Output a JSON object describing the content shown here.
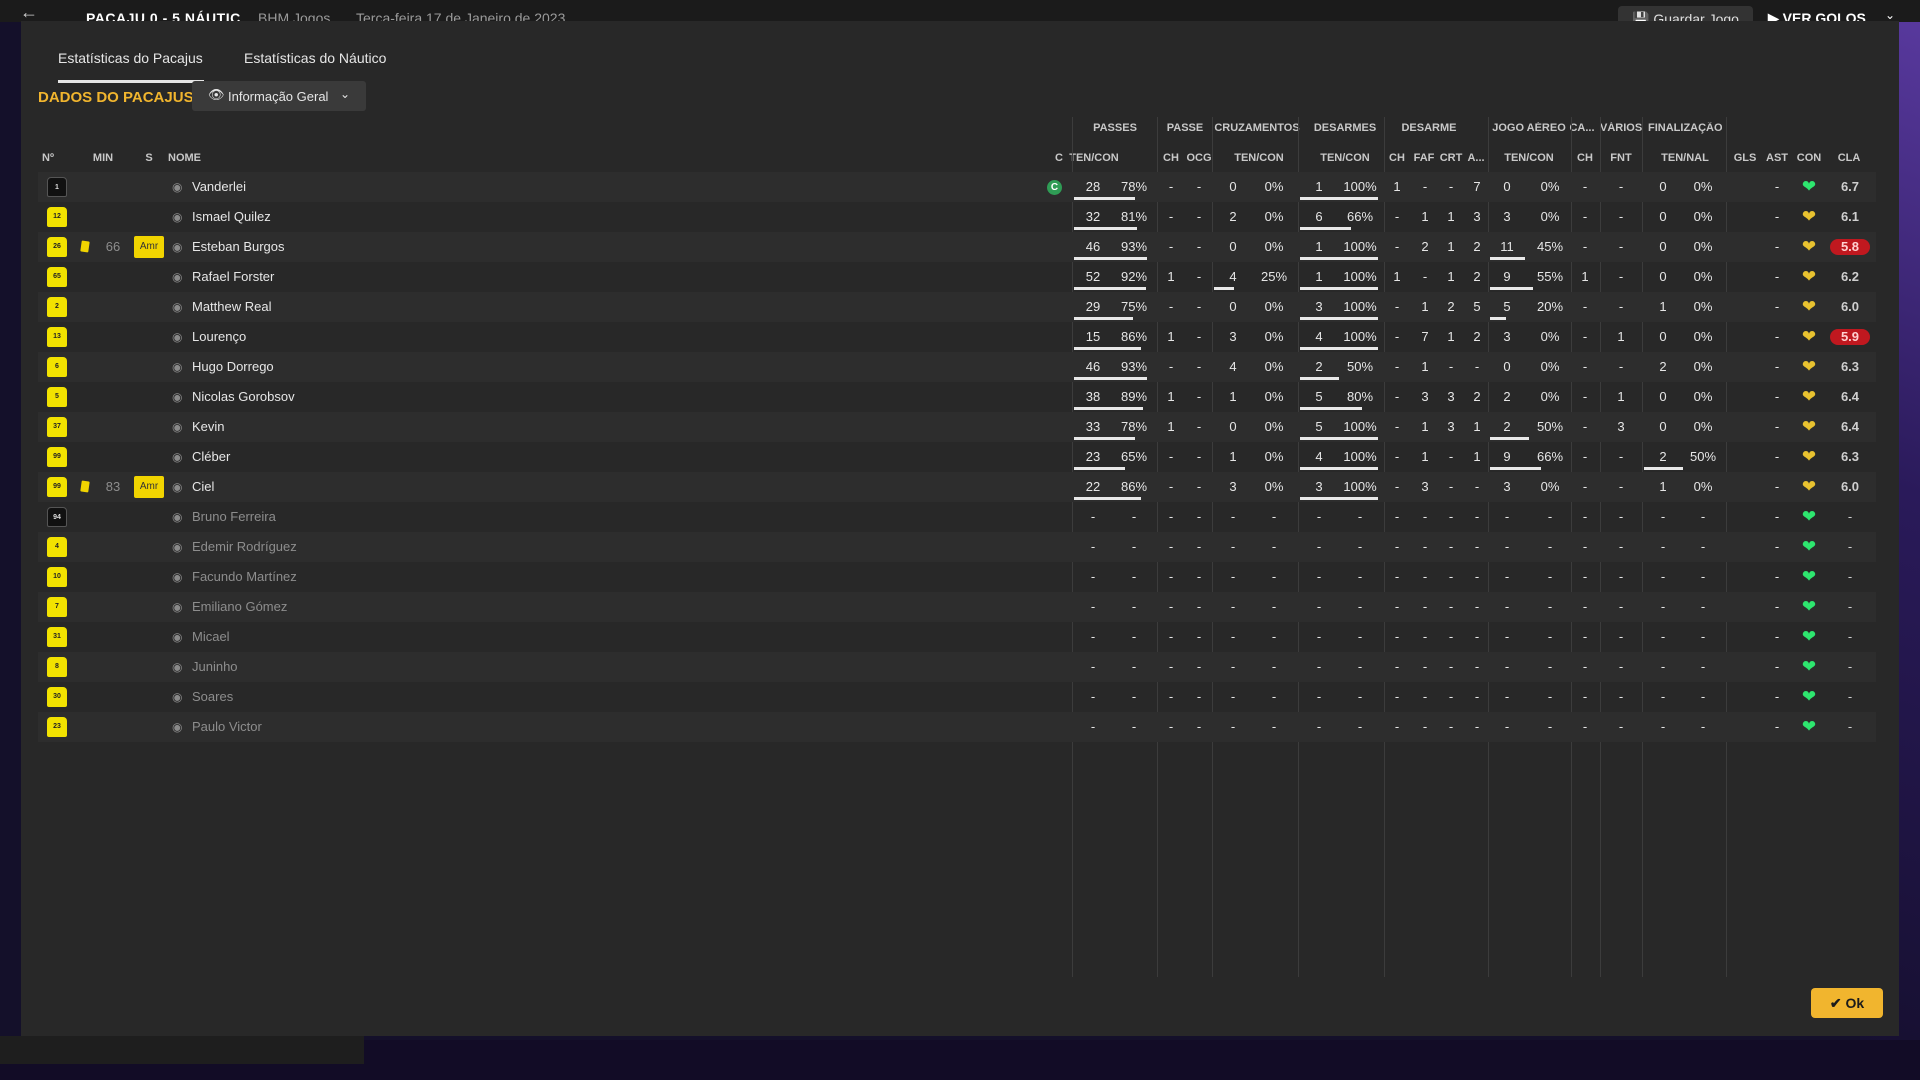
{
  "topbar": {
    "back_icon": "arrow-left-icon",
    "score": "PACAJU 0 - 5 NÁUTIC",
    "competition": "BHM Jogos",
    "date": "Terça-feira 17 de Janeiro de 2023",
    "save_button": "Guardar Jogo",
    "goals_button": "VER GOLOS"
  },
  "tabs": [
    "Estatísticas do Pacajus",
    "Estatísticas do Náutico"
  ],
  "section_title": "DADOS DO PACAJUS",
  "view_dropdown": "Informação Geral",
  "group_headers": [
    "PASSES",
    "PASSE",
    "CRUZAMENTOS",
    "DESARMES",
    "DESARME",
    "JOGO AÉREO",
    "CA...",
    "VÁRIOS",
    "FINALIZAÇÃO"
  ],
  "columns": [
    "Nº",
    "MIN",
    "S",
    "NOME",
    "C",
    "TEN/CON",
    "CH",
    "OCG",
    "TEN/CON",
    "TEN/CON",
    "CH",
    "FAF",
    "CRT",
    "A...",
    "TEN/CON",
    "CH",
    "FNT",
    "TEN/NAL",
    "GLS",
    "AST",
    "CON",
    "CLA"
  ],
  "colors": {
    "accent": "#f1b52e",
    "shirt": "#f2e200",
    "heart_green": "#2ee66f",
    "heart_yellow": "#e8c230",
    "bad_rating": "#c0181f"
  },
  "players": [
    {
      "num": "1",
      "gk": true,
      "min": "",
      "card": false,
      "role": "",
      "name": "Vanderlei",
      "captain": true,
      "pass_t": "28",
      "pass_p": "78%",
      "pass_bar": 78,
      "pch": "-",
      "ocg": "-",
      "cru_t": "0",
      "cru_p": "0%",
      "cru_bar": 0,
      "des_t": "1",
      "des_p": "100%",
      "des_bar": 100,
      "dch": "1",
      "faf": "-",
      "crt": "-",
      "a": "7",
      "air_t": "0",
      "air_p": "0%",
      "air_bar": 0,
      "ca": "-",
      "fnt": "-",
      "fin_t": "0",
      "fin_p": "0%",
      "fin_bar": 0,
      "gls": "",
      "ast": "-",
      "heart": "green",
      "rating": "6.7",
      "bad": false
    },
    {
      "num": "12",
      "gk": false,
      "min": "",
      "card": false,
      "role": "",
      "name": "Ismael Quilez",
      "captain": false,
      "pass_t": "32",
      "pass_p": "81%",
      "pass_bar": 81,
      "pch": "-",
      "ocg": "-",
      "cru_t": "2",
      "cru_p": "0%",
      "cru_bar": 0,
      "des_t": "6",
      "des_p": "66%",
      "des_bar": 66,
      "dch": "-",
      "faf": "1",
      "crt": "1",
      "a": "3",
      "air_t": "3",
      "air_p": "0%",
      "air_bar": 0,
      "ca": "-",
      "fnt": "-",
      "fin_t": "0",
      "fin_p": "0%",
      "fin_bar": 0,
      "gls": "",
      "ast": "-",
      "heart": "yellow",
      "rating": "6.1",
      "bad": false
    },
    {
      "num": "26",
      "gk": false,
      "min": "66",
      "card": true,
      "role": "Amr",
      "name": "Esteban Burgos",
      "captain": false,
      "pass_t": "46",
      "pass_p": "93%",
      "pass_bar": 93,
      "pch": "-",
      "ocg": "-",
      "cru_t": "0",
      "cru_p": "0%",
      "cru_bar": 0,
      "des_t": "1",
      "des_p": "100%",
      "des_bar": 100,
      "dch": "-",
      "faf": "2",
      "crt": "1",
      "a": "2",
      "air_t": "11",
      "air_p": "45%",
      "air_bar": 45,
      "ca": "-",
      "fnt": "-",
      "fin_t": "0",
      "fin_p": "0%",
      "fin_bar": 0,
      "gls": "",
      "ast": "-",
      "heart": "yellow",
      "rating": "5.8",
      "bad": true
    },
    {
      "num": "65",
      "gk": false,
      "min": "",
      "card": false,
      "role": "",
      "name": "Rafael Forster",
      "captain": false,
      "pass_t": "52",
      "pass_p": "92%",
      "pass_bar": 92,
      "pch": "1",
      "ocg": "-",
      "cru_t": "4",
      "cru_p": "25%",
      "cru_bar": 25,
      "des_t": "1",
      "des_p": "100%",
      "des_bar": 100,
      "dch": "1",
      "faf": "-",
      "crt": "1",
      "a": "2",
      "air_t": "9",
      "air_p": "55%",
      "air_bar": 55,
      "ca": "1",
      "fnt": "-",
      "fin_t": "0",
      "fin_p": "0%",
      "fin_bar": 0,
      "gls": "",
      "ast": "-",
      "heart": "yellow",
      "rating": "6.2",
      "bad": false
    },
    {
      "num": "2",
      "gk": false,
      "min": "",
      "card": false,
      "role": "",
      "name": "Matthew Real",
      "captain": false,
      "pass_t": "29",
      "pass_p": "75%",
      "pass_bar": 75,
      "pch": "-",
      "ocg": "-",
      "cru_t": "0",
      "cru_p": "0%",
      "cru_bar": 0,
      "des_t": "3",
      "des_p": "100%",
      "des_bar": 100,
      "dch": "-",
      "faf": "1",
      "crt": "2",
      "a": "5",
      "air_t": "5",
      "air_p": "20%",
      "air_bar": 20,
      "ca": "-",
      "fnt": "-",
      "fin_t": "1",
      "fin_p": "0%",
      "fin_bar": 0,
      "gls": "",
      "ast": "-",
      "heart": "yellow",
      "rating": "6.0",
      "bad": false
    },
    {
      "num": "13",
      "gk": false,
      "min": "",
      "card": false,
      "role": "",
      "name": "Lourenço",
      "captain": false,
      "pass_t": "15",
      "pass_p": "86%",
      "pass_bar": 86,
      "pch": "1",
      "ocg": "-",
      "cru_t": "3",
      "cru_p": "0%",
      "cru_bar": 0,
      "des_t": "4",
      "des_p": "100%",
      "des_bar": 100,
      "dch": "-",
      "faf": "7",
      "crt": "1",
      "a": "2",
      "air_t": "3",
      "air_p": "0%",
      "air_bar": 0,
      "ca": "-",
      "fnt": "1",
      "fin_t": "0",
      "fin_p": "0%",
      "fin_bar": 0,
      "gls": "",
      "ast": "-",
      "heart": "yellow",
      "rating": "5.9",
      "bad": true
    },
    {
      "num": "6",
      "gk": false,
      "min": "",
      "card": false,
      "role": "",
      "name": "Hugo Dorrego",
      "captain": false,
      "pass_t": "46",
      "pass_p": "93%",
      "pass_bar": 93,
      "pch": "-",
      "ocg": "-",
      "cru_t": "4",
      "cru_p": "0%",
      "cru_bar": 0,
      "des_t": "2",
      "des_p": "50%",
      "des_bar": 50,
      "dch": "-",
      "faf": "1",
      "crt": "-",
      "a": "-",
      "air_t": "0",
      "air_p": "0%",
      "air_bar": 0,
      "ca": "-",
      "fnt": "-",
      "fin_t": "2",
      "fin_p": "0%",
      "fin_bar": 0,
      "gls": "",
      "ast": "-",
      "heart": "yellow",
      "rating": "6.3",
      "bad": false
    },
    {
      "num": "5",
      "gk": false,
      "min": "",
      "card": false,
      "role": "",
      "name": "Nicolas Gorobsov",
      "captain": false,
      "pass_t": "38",
      "pass_p": "89%",
      "pass_bar": 89,
      "pch": "1",
      "ocg": "-",
      "cru_t": "1",
      "cru_p": "0%",
      "cru_bar": 0,
      "des_t": "5",
      "des_p": "80%",
      "des_bar": 80,
      "dch": "-",
      "faf": "3",
      "crt": "3",
      "a": "2",
      "air_t": "2",
      "air_p": "0%",
      "air_bar": 0,
      "ca": "-",
      "fnt": "1",
      "fin_t": "0",
      "fin_p": "0%",
      "fin_bar": 0,
      "gls": "",
      "ast": "-",
      "heart": "yellow",
      "rating": "6.4",
      "bad": false
    },
    {
      "num": "37",
      "gk": false,
      "min": "",
      "card": false,
      "role": "",
      "name": "Kevin",
      "captain": false,
      "pass_t": "33",
      "pass_p": "78%",
      "pass_bar": 78,
      "pch": "1",
      "ocg": "-",
      "cru_t": "0",
      "cru_p": "0%",
      "cru_bar": 0,
      "des_t": "5",
      "des_p": "100%",
      "des_bar": 100,
      "dch": "-",
      "faf": "1",
      "crt": "3",
      "a": "1",
      "air_t": "2",
      "air_p": "50%",
      "air_bar": 50,
      "ca": "-",
      "fnt": "3",
      "fin_t": "0",
      "fin_p": "0%",
      "fin_bar": 0,
      "gls": "",
      "ast": "-",
      "heart": "yellow",
      "rating": "6.4",
      "bad": false
    },
    {
      "num": "99",
      "gk": false,
      "min": "",
      "card": false,
      "role": "",
      "name": "Cléber",
      "captain": false,
      "pass_t": "23",
      "pass_p": "65%",
      "pass_bar": 65,
      "pch": "-",
      "ocg": "-",
      "cru_t": "1",
      "cru_p": "0%",
      "cru_bar": 0,
      "des_t": "4",
      "des_p": "100%",
      "des_bar": 100,
      "dch": "-",
      "faf": "1",
      "crt": "-",
      "a": "1",
      "air_t": "9",
      "air_p": "66%",
      "air_bar": 66,
      "ca": "-",
      "fnt": "-",
      "fin_t": "2",
      "fin_p": "50%",
      "fin_bar": 50,
      "gls": "",
      "ast": "-",
      "heart": "yellow",
      "rating": "6.3",
      "bad": false
    },
    {
      "num": "99",
      "gk": false,
      "min": "83",
      "card": true,
      "role": "Amr",
      "name": "Ciel",
      "captain": false,
      "pass_t": "22",
      "pass_p": "86%",
      "pass_bar": 86,
      "pch": "-",
      "ocg": "-",
      "cru_t": "3",
      "cru_p": "0%",
      "cru_bar": 0,
      "des_t": "3",
      "des_p": "100%",
      "des_bar": 100,
      "dch": "-",
      "faf": "3",
      "crt": "-",
      "a": "-",
      "air_t": "3",
      "air_p": "0%",
      "air_bar": 0,
      "ca": "-",
      "fnt": "-",
      "fin_t": "1",
      "fin_p": "0%",
      "fin_bar": 0,
      "gls": "",
      "ast": "-",
      "heart": "yellow",
      "rating": "6.0",
      "bad": false
    },
    {
      "num": "94",
      "gk": true,
      "sub": true,
      "name": "Bruno Ferreira",
      "heart": "green"
    },
    {
      "num": "4",
      "sub": true,
      "name": "Edemir Rodríguez",
      "heart": "green"
    },
    {
      "num": "10",
      "sub": true,
      "name": "Facundo Martínez",
      "heart": "green"
    },
    {
      "num": "7",
      "sub": true,
      "name": "Emiliano Gómez",
      "heart": "green"
    },
    {
      "num": "31",
      "sub": true,
      "name": "Micael",
      "heart": "green"
    },
    {
      "num": "8",
      "sub": true,
      "name": "Juninho",
      "heart": "green"
    },
    {
      "num": "30",
      "sub": true,
      "name": "Soares",
      "heart": "green"
    },
    {
      "num": "23",
      "sub": true,
      "name": "Paulo Victor",
      "heart": "green"
    }
  ],
  "ok_button": "Ok"
}
